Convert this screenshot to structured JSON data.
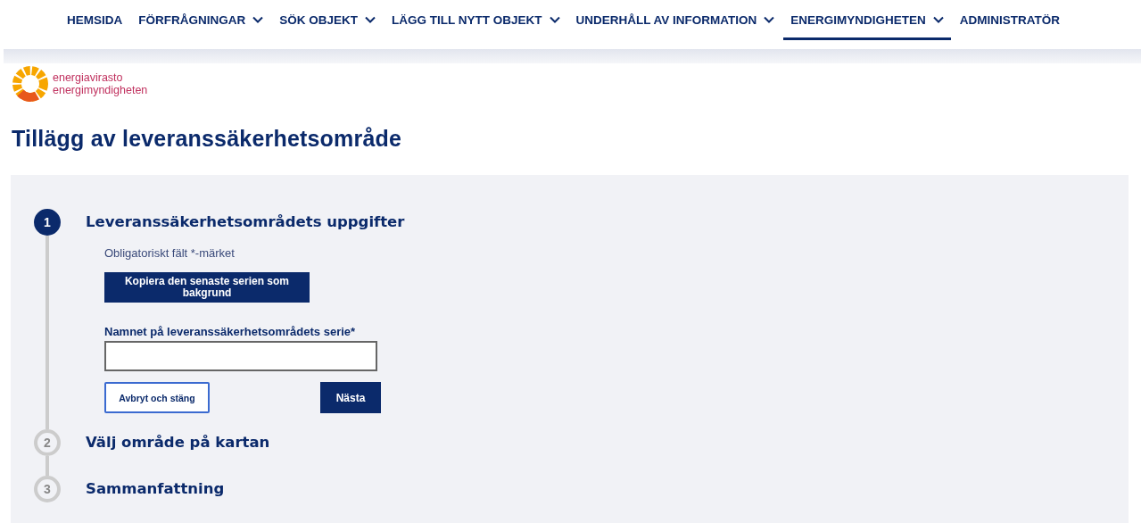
{
  "nav": [
    {
      "label": "HEMSIDA",
      "dropdown": false,
      "selected": false
    },
    {
      "label": "FÖRFRÅGNINGAR",
      "dropdown": true,
      "selected": false
    },
    {
      "label": "SÖK OBJEKT",
      "dropdown": true,
      "selected": false
    },
    {
      "label": "LÄGG TILL NYTT OBJEKT",
      "dropdown": true,
      "selected": false
    },
    {
      "label": "UNDERHÅLL AV INFORMATION",
      "dropdown": true,
      "selected": false
    },
    {
      "label": "ENERGIMYNDIGHETEN",
      "dropdown": true,
      "selected": true
    },
    {
      "label": "ADMINISTRATÖR",
      "dropdown": false,
      "selected": false
    }
  ],
  "logo": {
    "line_1": "energiavirasto",
    "line_2": "energimyndigheten"
  },
  "page_title": "Tillägg av leveranssäkerhetsområde",
  "steps": [
    {
      "number": "1",
      "title": "Leveranssäkerhetsområdets uppgifter",
      "active": true
    },
    {
      "number": "2",
      "title": "Välj område på kartan",
      "active": false
    },
    {
      "number": "3",
      "title": "Sammanfattning",
      "active": false
    }
  ],
  "form": {
    "required_note": "Obligatoriskt fält *-märket",
    "copy_button": "Kopiera den senaste serien som bakgrund",
    "field_label": "Namnet på leveranssäkerhetsområdets serie*",
    "cancel_button": "Avbryt och stäng",
    "next_button": "Nästa"
  }
}
